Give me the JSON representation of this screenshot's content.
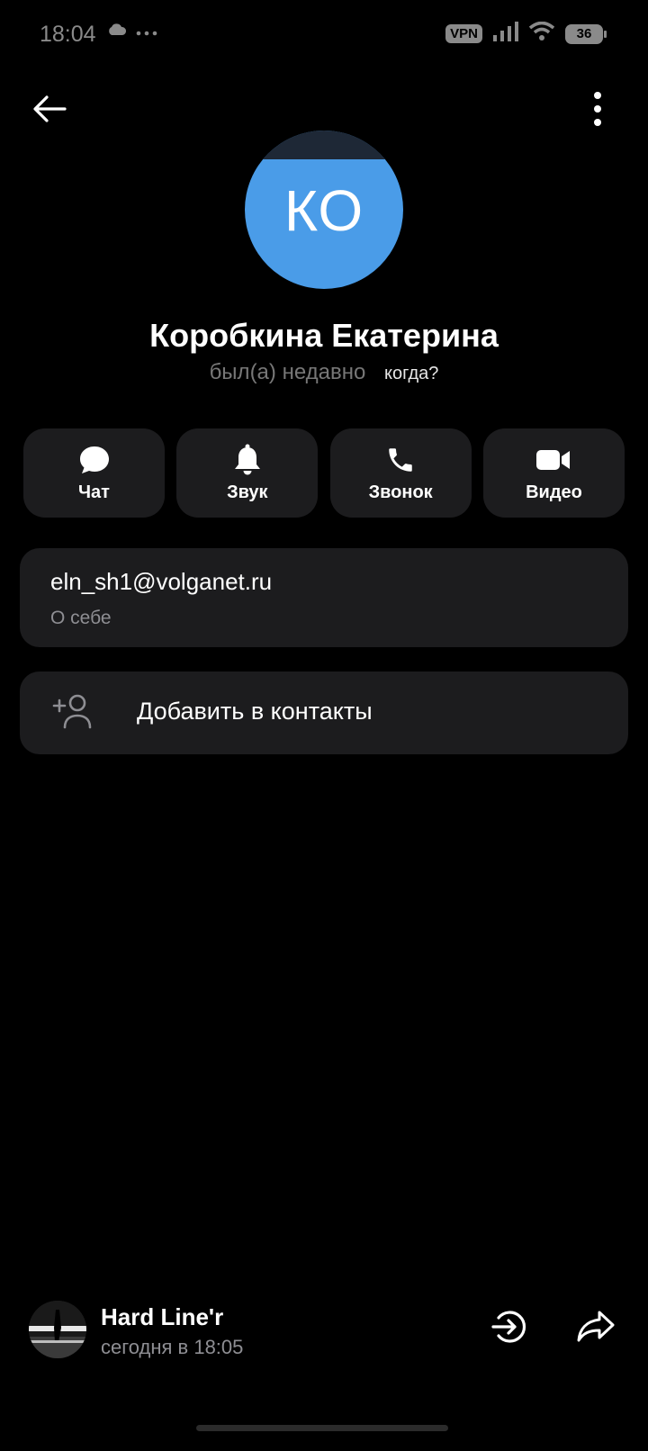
{
  "status_bar": {
    "time": "18:04",
    "left_icons": [
      "cloud-icon",
      "more-dots-icon"
    ],
    "vpn": "VPN",
    "battery": "36"
  },
  "header": {
    "back_icon": "arrow-left-icon",
    "menu_icon": "more-vert-icon"
  },
  "profile": {
    "initials": "КО",
    "avatar_color": "#4a9ce8",
    "name": "Коробкина Екатерина",
    "last_seen": "был(а) недавно",
    "when_link": "когда?"
  },
  "actions": [
    {
      "label": "Чат",
      "icon": "chat-bubble-icon"
    },
    {
      "label": "Звук",
      "icon": "bell-icon"
    },
    {
      "label": "Звонок",
      "icon": "phone-icon"
    },
    {
      "label": "Видео",
      "icon": "video-camera-icon"
    }
  ],
  "info": {
    "value": "eln_sh1@volganet.ru",
    "label": "О себе"
  },
  "add_contact": {
    "label": "Добавить в контакты",
    "icon": "add-person-icon"
  },
  "player": {
    "title": "Hard Line'r",
    "time": "сегодня в 18:05"
  },
  "colors": {
    "background": "#000000",
    "card": "#1c1c1e",
    "secondary_text": "#8e8e93"
  }
}
